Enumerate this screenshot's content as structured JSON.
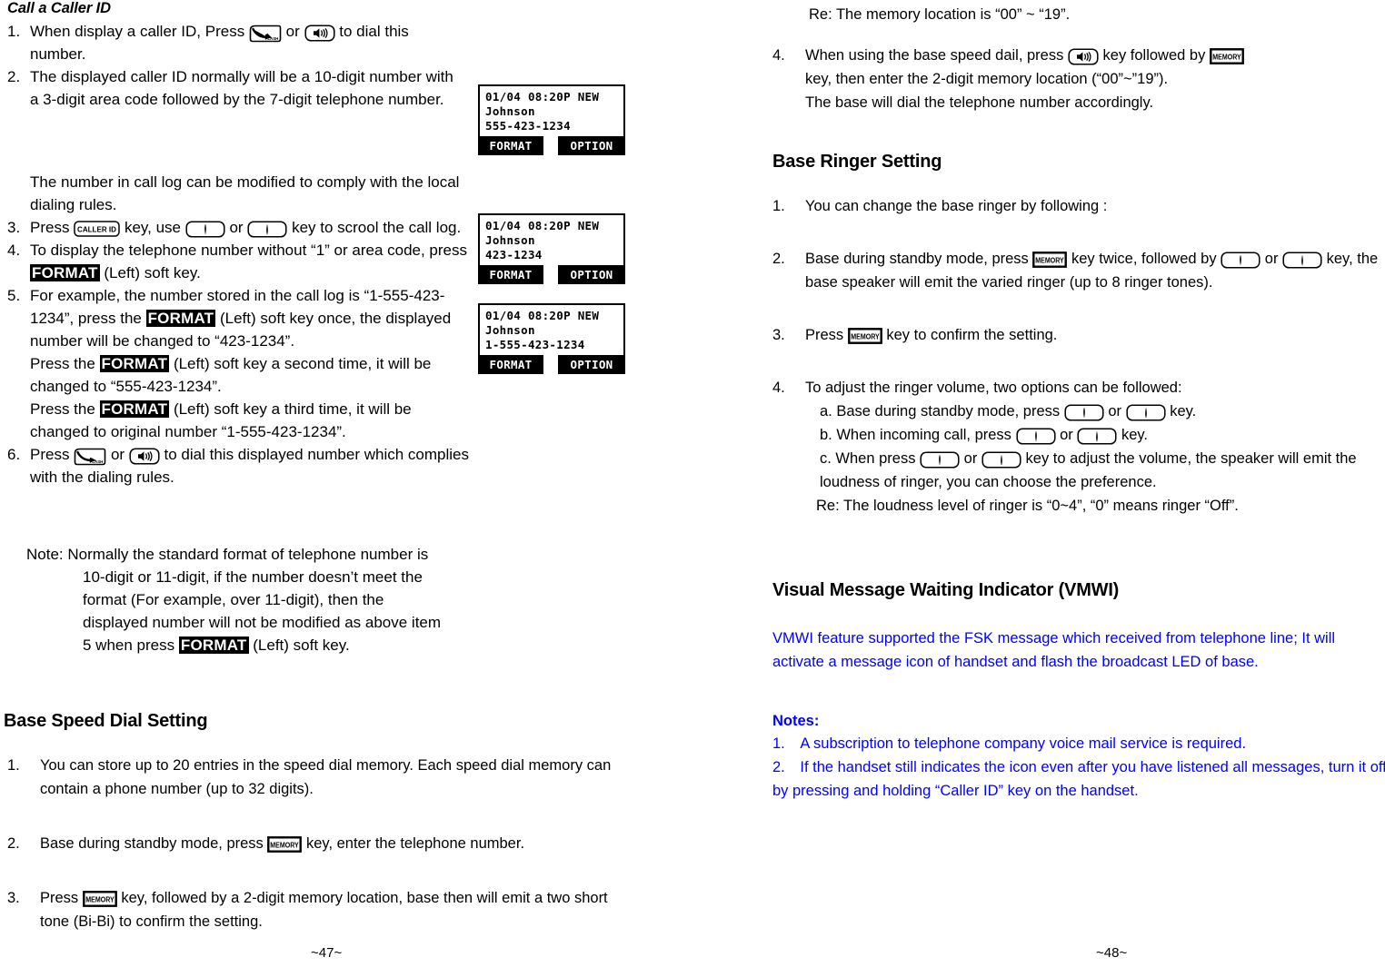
{
  "document": {
    "type": "telephone-user-manual-spread"
  },
  "icons": {
    "talk_flash": "talk-flash-key-icon",
    "speaker": "speakerphone-key-icon",
    "caller_id": "caller-id-key-icon",
    "memory": "memory-key-icon",
    "arrow_down": "down-arrow-key-icon",
    "arrow_up": "up-arrow-key-icon"
  },
  "colors": {
    "text": "#000000",
    "highlight_bg": "#000000",
    "highlight_fg": "#ffffff",
    "blue": "#0000ff"
  },
  "left_page": {
    "footer": "~47~",
    "caller_id_section": {
      "heading": "Call a Caller ID",
      "items": {
        "i1_a": "When display a caller ID, Press",
        "i1_b": "or",
        "i1_c": "to dial this number.",
        "i2": "The displayed caller ID normally will be a 10-digit number with a 3-digit area code followed by the 7-digit telephone number.",
        "i2_extra": "The number in call log can be modified to comply with the local dialing rules.",
        "i3_a": "Press",
        "i3_b": "key, use",
        "i3_c": "or",
        "i3_d": "key to scrool the call log.",
        "i4_a": "To display the telephone number without “1” or area code, press",
        "i4_key": "FORMAT",
        "i4_b": "(Left) soft key.",
        "i5_a": "For example, the number stored in the call log is “1-555-423-1234”, press the",
        "i5_key": "FORMAT",
        "i5_b": "(Left) soft key once, the displayed number will be changed to “423-1234”.",
        "i5_c": "Press the",
        "i5_key2": "FORMAT",
        "i5_d": "(Left) soft key a second time, it will be changed to “555-423-1234”.",
        "i5_e": "Press the",
        "i5_key3": "FORMAT",
        "i5_f": "(Left) soft key a third time, it will be changed to original number “1-555-423-1234”.",
        "i6_a": "Press",
        "i6_b": "or",
        "i6_c": "to dial this displayed number which complies with the dialing rules."
      },
      "note": {
        "label": "Note:",
        "text_a": "Normally the standard format of telephone number is 10-digit or 11-digit, if the number doesn’t meet the format (For example, over 11-digit), then the displayed number will not be modified as above item 5 when press",
        "key": "FORMAT",
        "text_b": "(Left) soft key."
      }
    },
    "lcd_displays": [
      {
        "line1": "01/04 08:20P NEW",
        "line2": "Johnson",
        "line3": "555-423-1234",
        "softkey_left": "FORMAT",
        "softkey_right": "OPTION"
      },
      {
        "line1": "01/04 08:20P NEW",
        "line2": "Johnson",
        "line3": "423-1234",
        "softkey_left": "FORMAT",
        "softkey_right": "OPTION"
      },
      {
        "line1": "01/04 08:20P NEW",
        "line2": "Johnson",
        "line3": "1-555-423-1234",
        "softkey_left": "FORMAT",
        "softkey_right": "OPTION"
      }
    ],
    "speed_dial_section": {
      "heading": "Base Speed Dial Setting",
      "items": {
        "i1": "You can store up to 20 entries in the speed dial memory.  Each speed dial memory can contain a phone number (up to 32 digits).",
        "i2_a": "Base during standby mode, press",
        "i2_b": "key, enter the telephone number.",
        "i3_a": "Press",
        "i3_b": "key, followed by a 2-digit memory location, base then will emit a two short tone (Bi-Bi) to confirm the setting."
      }
    }
  },
  "right_page": {
    "footer": "~48~",
    "speed_dial_cont": {
      "re_line": "Re: The memory location is “00” ~ “19”.",
      "i4_a": "When using the base speed dail, press",
      "i4_b": "key followed by",
      "i4_c": "key, then enter the 2-digit memory location (“00”~”19”).",
      "i4_d": "The base will dial the telephone number accordingly."
    },
    "ringer_section": {
      "heading": "Base Ringer Setting",
      "items": {
        "i1": "You can change the base ringer by following :",
        "i2_a": "Base during standby mode, press",
        "i2_b": "key twice, followed by",
        "i2_c": "or",
        "i2_d": "key, the base speaker will emit the varied ringer (up to 8 ringer tones).",
        "i3_a": "Press",
        "i3_b": "key to confirm the setting.",
        "i4_intro": "To adjust the ringer volume, two options can be followed:",
        "i4_a1": "a. Base during standby mode, press",
        "i4_a2": "or",
        "i4_a3": "key.",
        "i4_b1": "b. When incoming call, press",
        "i4_b2": "or",
        "i4_b3": "key.",
        "i4_c1": "c. When press",
        "i4_c2": "or",
        "i4_c3": "key to adjust the volume, the speaker will emit the loudness of ringer, you can choose the preference.",
        "i4_re": "Re: The loudness level of ringer is “0~4”, “0” means ringer “Off”."
      }
    },
    "vmwi_section": {
      "heading": "Visual Message Waiting Indicator (VMWI)",
      "body": "VMWI feature supported the FSK message which received from telephone line; It will activate a message icon of handset and flash the broadcast LED of base.",
      "notes_label": "Notes:",
      "notes": [
        {
          "num": "1.",
          "text": "A subscription to telephone company voice mail service is required."
        },
        {
          "num": "2.",
          "text": "If the handset still indicates the icon even after you have listened all messages, turn it off by pressing and holding “Caller ID” key on the handset."
        }
      ]
    }
  }
}
